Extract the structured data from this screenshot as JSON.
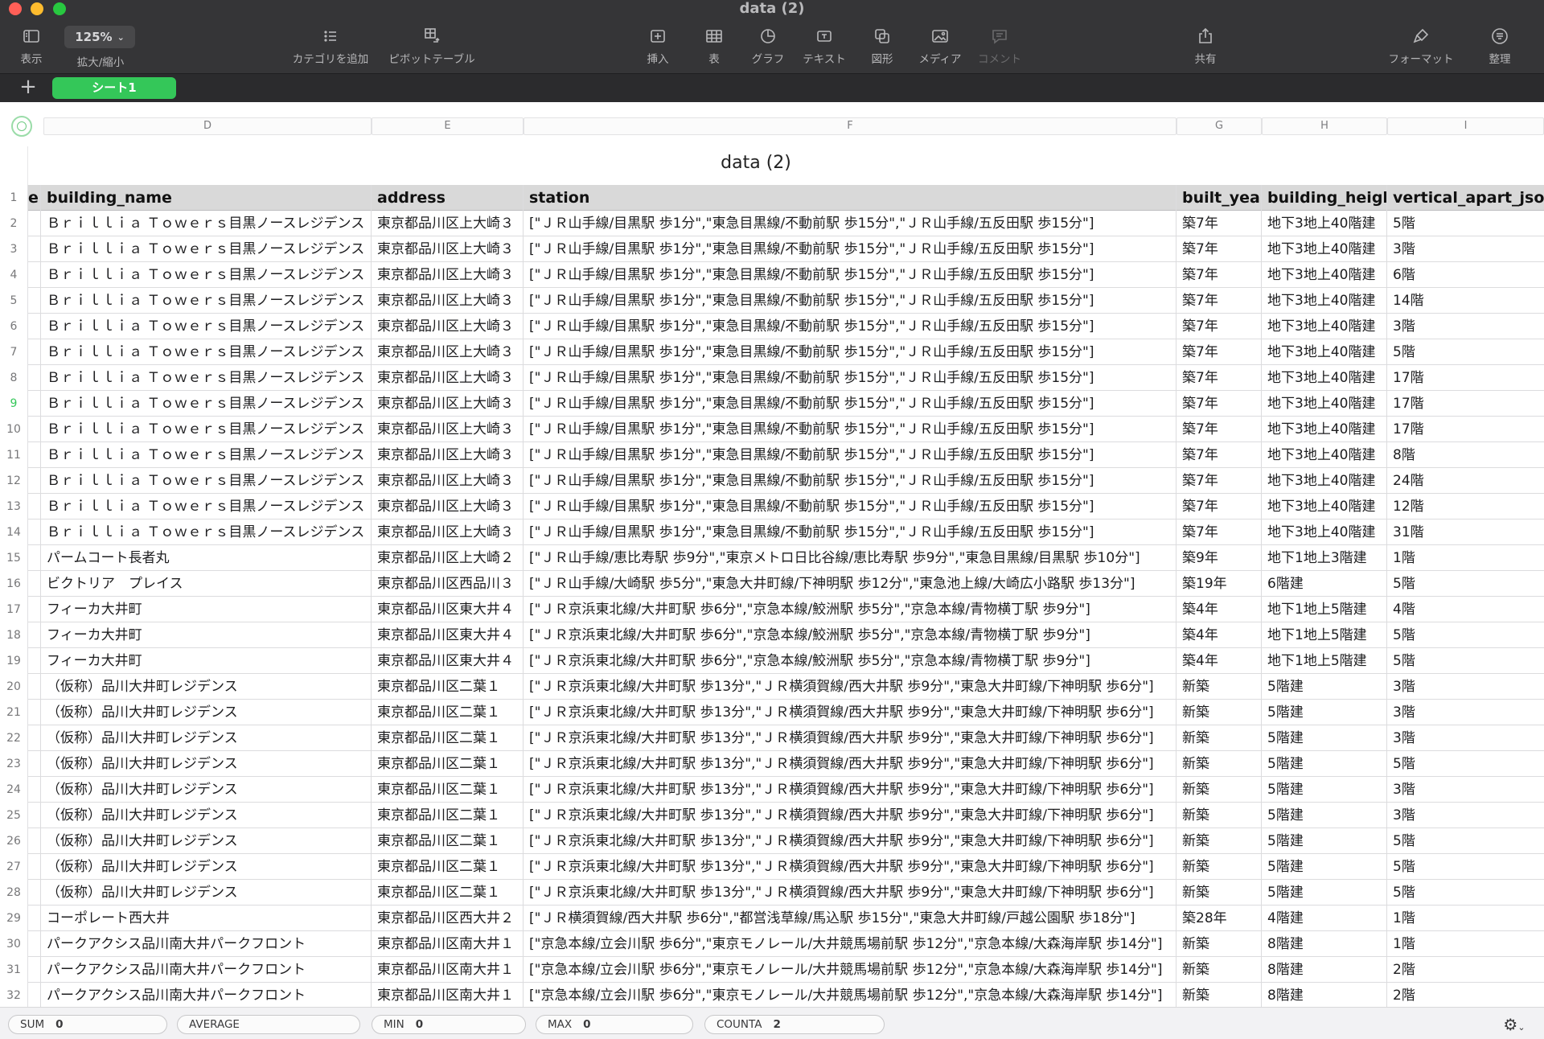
{
  "window": {
    "title": "data (2)"
  },
  "toolbar": {
    "view": "表示",
    "zoom_value": "125%",
    "zoom_label": "拡大/縮小",
    "add_category": "カテゴリを追加",
    "pivot_table": "ピボットテーブル",
    "insert": "挿入",
    "table": "表",
    "chart": "グラフ",
    "text": "テキスト",
    "shape": "図形",
    "media": "メディア",
    "comment": "コメント",
    "share": "共有",
    "format": "フォーマット",
    "organize": "整理"
  },
  "sheet": {
    "add": "+",
    "tab_name": "シート1"
  },
  "columns": [
    "D",
    "E",
    "F",
    "G",
    "H",
    "I"
  ],
  "table": {
    "title": "data (2)",
    "headers": [
      "e",
      "building_name",
      "address",
      "station",
      "built_year",
      "building_height",
      "vertical_apart_jsons"
    ],
    "selected_row": "9",
    "rows": [
      [
        "2",
        "Ｂｒｉｌｌｉａ Ｔｏｗｅｒｓ目黒ノースレジデンス",
        "東京都品川区上大崎３",
        "[\"ＪＲ山手線/目黒駅 歩1分\",\"東急目黒線/不動前駅 歩15分\",\"ＪＲ山手線/五反田駅 歩15分\"]",
        "築7年",
        "地下3地上40階建",
        "5階"
      ],
      [
        "3",
        "Ｂｒｉｌｌｉａ Ｔｏｗｅｒｓ目黒ノースレジデンス",
        "東京都品川区上大崎３",
        "[\"ＪＲ山手線/目黒駅 歩1分\",\"東急目黒線/不動前駅 歩15分\",\"ＪＲ山手線/五反田駅 歩15分\"]",
        "築7年",
        "地下3地上40階建",
        "3階"
      ],
      [
        "4",
        "Ｂｒｉｌｌｉａ Ｔｏｗｅｒｓ目黒ノースレジデンス",
        "東京都品川区上大崎３",
        "[\"ＪＲ山手線/目黒駅 歩1分\",\"東急目黒線/不動前駅 歩15分\",\"ＪＲ山手線/五反田駅 歩15分\"]",
        "築7年",
        "地下3地上40階建",
        "6階"
      ],
      [
        "5",
        "Ｂｒｉｌｌｉａ Ｔｏｗｅｒｓ目黒ノースレジデンス",
        "東京都品川区上大崎３",
        "[\"ＪＲ山手線/目黒駅 歩1分\",\"東急目黒線/不動前駅 歩15分\",\"ＪＲ山手線/五反田駅 歩15分\"]",
        "築7年",
        "地下3地上40階建",
        "14階"
      ],
      [
        "6",
        "Ｂｒｉｌｌｉａ Ｔｏｗｅｒｓ目黒ノースレジデンス",
        "東京都品川区上大崎３",
        "[\"ＪＲ山手線/目黒駅 歩1分\",\"東急目黒線/不動前駅 歩15分\",\"ＪＲ山手線/五反田駅 歩15分\"]",
        "築7年",
        "地下3地上40階建",
        "3階"
      ],
      [
        "7",
        "Ｂｒｉｌｌｉａ Ｔｏｗｅｒｓ目黒ノースレジデンス",
        "東京都品川区上大崎３",
        "[\"ＪＲ山手線/目黒駅 歩1分\",\"東急目黒線/不動前駅 歩15分\",\"ＪＲ山手線/五反田駅 歩15分\"]",
        "築7年",
        "地下3地上40階建",
        "5階"
      ],
      [
        "8",
        "Ｂｒｉｌｌｉａ Ｔｏｗｅｒｓ目黒ノースレジデンス",
        "東京都品川区上大崎３",
        "[\"ＪＲ山手線/目黒駅 歩1分\",\"東急目黒線/不動前駅 歩15分\",\"ＪＲ山手線/五反田駅 歩15分\"]",
        "築7年",
        "地下3地上40階建",
        "17階"
      ],
      [
        "9",
        "Ｂｒｉｌｌｉａ Ｔｏｗｅｒｓ目黒ノースレジデンス",
        "東京都品川区上大崎３",
        "[\"ＪＲ山手線/目黒駅 歩1分\",\"東急目黒線/不動前駅 歩15分\",\"ＪＲ山手線/五反田駅 歩15分\"]",
        "築7年",
        "地下3地上40階建",
        "17階"
      ],
      [
        "10",
        "Ｂｒｉｌｌｉａ Ｔｏｗｅｒｓ目黒ノースレジデンス",
        "東京都品川区上大崎３",
        "[\"ＪＲ山手線/目黒駅 歩1分\",\"東急目黒線/不動前駅 歩15分\",\"ＪＲ山手線/五反田駅 歩15分\"]",
        "築7年",
        "地下3地上40階建",
        "17階"
      ],
      [
        "11",
        "Ｂｒｉｌｌｉａ Ｔｏｗｅｒｓ目黒ノースレジデンス",
        "東京都品川区上大崎３",
        "[\"ＪＲ山手線/目黒駅 歩1分\",\"東急目黒線/不動前駅 歩15分\",\"ＪＲ山手線/五反田駅 歩15分\"]",
        "築7年",
        "地下3地上40階建",
        "8階"
      ],
      [
        "12",
        "Ｂｒｉｌｌｉａ Ｔｏｗｅｒｓ目黒ノースレジデンス",
        "東京都品川区上大崎３",
        "[\"ＪＲ山手線/目黒駅 歩1分\",\"東急目黒線/不動前駅 歩15分\",\"ＪＲ山手線/五反田駅 歩15分\"]",
        "築7年",
        "地下3地上40階建",
        "24階"
      ],
      [
        "13",
        "Ｂｒｉｌｌｉａ Ｔｏｗｅｒｓ目黒ノースレジデンス",
        "東京都品川区上大崎３",
        "[\"ＪＲ山手線/目黒駅 歩1分\",\"東急目黒線/不動前駅 歩15分\",\"ＪＲ山手線/五反田駅 歩15分\"]",
        "築7年",
        "地下3地上40階建",
        "12階"
      ],
      [
        "14",
        "Ｂｒｉｌｌｉａ Ｔｏｗｅｒｓ目黒ノースレジデンス",
        "東京都品川区上大崎３",
        "[\"ＪＲ山手線/目黒駅 歩1分\",\"東急目黒線/不動前駅 歩15分\",\"ＪＲ山手線/五反田駅 歩15分\"]",
        "築7年",
        "地下3地上40階建",
        "31階"
      ],
      [
        "15",
        "パームコート長者丸",
        "東京都品川区上大崎２",
        "[\"ＪＲ山手線/恵比寿駅 歩9分\",\"東京メトロ日比谷線/恵比寿駅 歩9分\",\"東急目黒線/目黒駅 歩10分\"]",
        "築9年",
        "地下1地上3階建",
        "1階"
      ],
      [
        "16",
        "ビクトリア　プレイス",
        "東京都品川区西品川３",
        "[\"ＪＲ山手線/大崎駅 歩5分\",\"東急大井町線/下神明駅 歩12分\",\"東急池上線/大崎広小路駅 歩13分\"]",
        "築19年",
        "6階建",
        "5階"
      ],
      [
        "17",
        "フィーカ大井町",
        "東京都品川区東大井４",
        "[\"ＪＲ京浜東北線/大井町駅 歩6分\",\"京急本線/鮫洲駅 歩5分\",\"京急本線/青物横丁駅 歩9分\"]",
        "築4年",
        "地下1地上5階建",
        "4階"
      ],
      [
        "18",
        "フィーカ大井町",
        "東京都品川区東大井４",
        "[\"ＪＲ京浜東北線/大井町駅 歩6分\",\"京急本線/鮫洲駅 歩5分\",\"京急本線/青物横丁駅 歩9分\"]",
        "築4年",
        "地下1地上5階建",
        "5階"
      ],
      [
        "19",
        "フィーカ大井町",
        "東京都品川区東大井４",
        "[\"ＪＲ京浜東北線/大井町駅 歩6分\",\"京急本線/鮫洲駅 歩5分\",\"京急本線/青物横丁駅 歩9分\"]",
        "築4年",
        "地下1地上5階建",
        "5階"
      ],
      [
        "20",
        "（仮称）品川大井町レジデンス",
        "東京都品川区二葉１",
        "[\"ＪＲ京浜東北線/大井町駅 歩13分\",\"ＪＲ横須賀線/西大井駅 歩9分\",\"東急大井町線/下神明駅 歩6分\"]",
        "新築",
        "5階建",
        "3階"
      ],
      [
        "21",
        "（仮称）品川大井町レジデンス",
        "東京都品川区二葉１",
        "[\"ＪＲ京浜東北線/大井町駅 歩13分\",\"ＪＲ横須賀線/西大井駅 歩9分\",\"東急大井町線/下神明駅 歩6分\"]",
        "新築",
        "5階建",
        "3階"
      ],
      [
        "22",
        "（仮称）品川大井町レジデンス",
        "東京都品川区二葉１",
        "[\"ＪＲ京浜東北線/大井町駅 歩13分\",\"ＪＲ横須賀線/西大井駅 歩9分\",\"東急大井町線/下神明駅 歩6分\"]",
        "新築",
        "5階建",
        "3階"
      ],
      [
        "23",
        "（仮称）品川大井町レジデンス",
        "東京都品川区二葉１",
        "[\"ＪＲ京浜東北線/大井町駅 歩13分\",\"ＪＲ横須賀線/西大井駅 歩9分\",\"東急大井町線/下神明駅 歩6分\"]",
        "新築",
        "5階建",
        "5階"
      ],
      [
        "24",
        "（仮称）品川大井町レジデンス",
        "東京都品川区二葉１",
        "[\"ＪＲ京浜東北線/大井町駅 歩13分\",\"ＪＲ横須賀線/西大井駅 歩9分\",\"東急大井町線/下神明駅 歩6分\"]",
        "新築",
        "5階建",
        "3階"
      ],
      [
        "25",
        "（仮称）品川大井町レジデンス",
        "東京都品川区二葉１",
        "[\"ＪＲ京浜東北線/大井町駅 歩13分\",\"ＪＲ横須賀線/西大井駅 歩9分\",\"東急大井町線/下神明駅 歩6分\"]",
        "新築",
        "5階建",
        "3階"
      ],
      [
        "26",
        "（仮称）品川大井町レジデンス",
        "東京都品川区二葉１",
        "[\"ＪＲ京浜東北線/大井町駅 歩13分\",\"ＪＲ横須賀線/西大井駅 歩9分\",\"東急大井町線/下神明駅 歩6分\"]",
        "新築",
        "5階建",
        "5階"
      ],
      [
        "27",
        "（仮称）品川大井町レジデンス",
        "東京都品川区二葉１",
        "[\"ＪＲ京浜東北線/大井町駅 歩13分\",\"ＪＲ横須賀線/西大井駅 歩9分\",\"東急大井町線/下神明駅 歩6分\"]",
        "新築",
        "5階建",
        "5階"
      ],
      [
        "28",
        "（仮称）品川大井町レジデンス",
        "東京都品川区二葉１",
        "[\"ＪＲ京浜東北線/大井町駅 歩13分\",\"ＪＲ横須賀線/西大井駅 歩9分\",\"東急大井町線/下神明駅 歩6分\"]",
        "新築",
        "5階建",
        "5階"
      ],
      [
        "29",
        "コーポレート西大井",
        "東京都品川区西大井２",
        "[\"ＪＲ横須賀線/西大井駅 歩6分\",\"都営浅草線/馬込駅 歩15分\",\"東急大井町線/戸越公園駅 歩18分\"]",
        "築28年",
        "4階建",
        "1階"
      ],
      [
        "30",
        "パークアクシス品川南大井パークフロント",
        "東京都品川区南大井１",
        "[\"京急本線/立会川駅 歩6分\",\"東京モノレール/大井競馬場前駅 歩12分\",\"京急本線/大森海岸駅 歩14分\"]",
        "新築",
        "8階建",
        "1階"
      ],
      [
        "31",
        "パークアクシス品川南大井パークフロント",
        "東京都品川区南大井１",
        "[\"京急本線/立会川駅 歩6分\",\"東京モノレール/大井競馬場前駅 歩12分\",\"京急本線/大森海岸駅 歩14分\"]",
        "新築",
        "8階建",
        "2階"
      ],
      [
        "32",
        "パークアクシス品川南大井パークフロント",
        "東京都品川区南大井１",
        "[\"京急本線/立会川駅 歩6分\",\"東京モノレール/大井競馬場前駅 歩12分\",\"京急本線/大森海岸駅 歩14分\"]",
        "新築",
        "8階建",
        "2階"
      ]
    ]
  },
  "status": {
    "sum_label": "SUM",
    "sum_value": "0",
    "average_label": "AVERAGE",
    "min_label": "MIN",
    "min_value": "0",
    "max_label": "MAX",
    "max_value": "0",
    "counta_label": "COUNTA",
    "counta_value": "2"
  },
  "icons": {
    "view": "sidebar-icon",
    "add_category": "list-icon",
    "pivot": "pivot-table-icon",
    "insert": "insert-icon",
    "table": "table-icon",
    "chart": "pie-chart-icon",
    "text": "text-box-icon",
    "shape": "shapes-icon",
    "media": "image-icon",
    "comment": "comment-icon",
    "share": "share-icon",
    "format": "paintbrush-icon",
    "organize": "organize-icon",
    "settings": "gear-icon"
  },
  "colors": {
    "accent": "#34c759",
    "toolbar_bg": "#353537",
    "header_row_bg": "#d9d9d9"
  }
}
